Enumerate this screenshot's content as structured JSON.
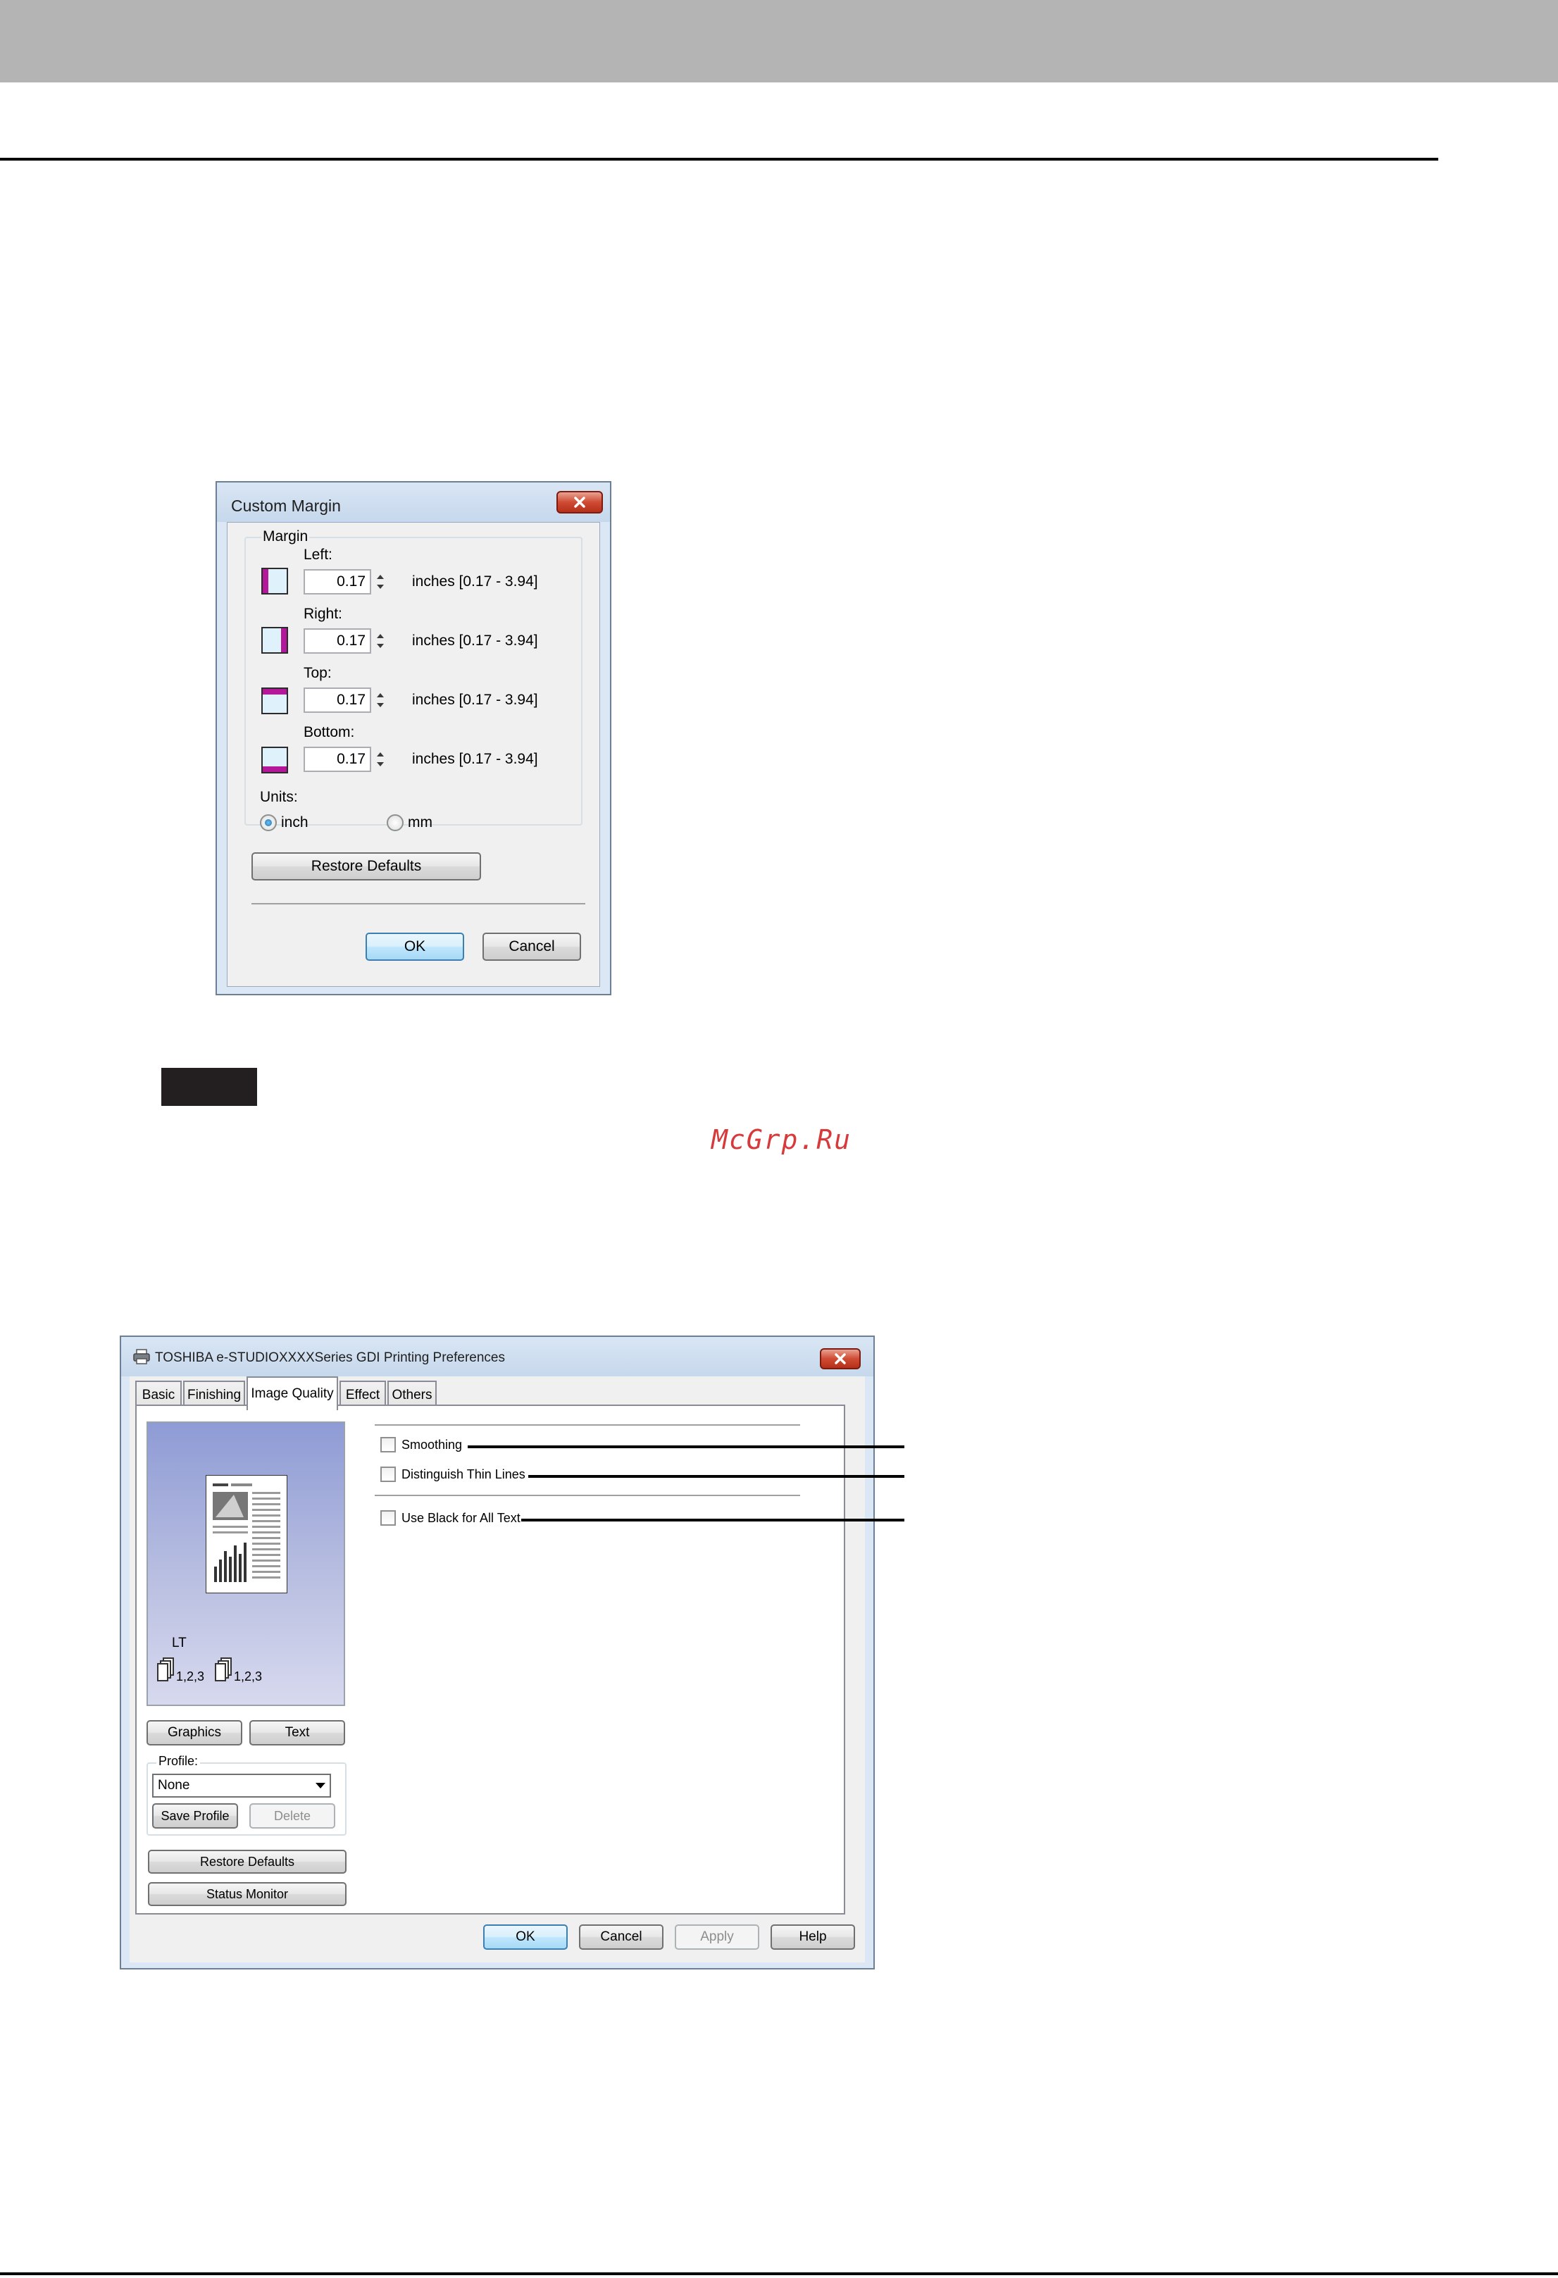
{
  "custom_margin": {
    "title": "Custom Margin",
    "group_label": "Margin",
    "fields": [
      {
        "label": "Left:",
        "value": "0.17",
        "range": "inches [0.17 - 3.94]"
      },
      {
        "label": "Right:",
        "value": "0.17",
        "range": "inches [0.17 - 3.94]"
      },
      {
        "label": "Top:",
        "value": "0.17",
        "range": "inches [0.17 - 3.94]"
      },
      {
        "label": "Bottom:",
        "value": "0.17",
        "range": "inches [0.17 - 3.94]"
      }
    ],
    "units_label": "Units:",
    "unit_options": [
      {
        "label": "inch",
        "selected": true
      },
      {
        "label": "mm",
        "selected": false
      }
    ],
    "restore_label": "Restore Defaults",
    "ok_label": "OK",
    "cancel_label": "Cancel"
  },
  "watermark": "McGrp.Ru",
  "prefs": {
    "title": "TOSHIBA e-STUDIOXXXXSeries GDI Printing Preferences",
    "tabs": [
      {
        "label": "Basic",
        "active": false
      },
      {
        "label": "Finishing",
        "active": false
      },
      {
        "label": "Image Quality",
        "active": true
      },
      {
        "label": "Effect",
        "active": false
      },
      {
        "label": "Others",
        "active": false
      }
    ],
    "preview": {
      "paper": "LT",
      "page_order_1": "1,2,3",
      "page_order_2": "1,2,3"
    },
    "graphics_label": "Graphics",
    "text_label": "Text",
    "profile_label": "Profile:",
    "profile_value": "None",
    "save_profile_label": "Save Profile",
    "delete_label": "Delete",
    "restore_label": "Restore Defaults",
    "status_monitor_label": "Status Monitor",
    "options": [
      {
        "label": "Smoothing",
        "checked": false
      },
      {
        "label": "Distinguish Thin Lines",
        "checked": false
      },
      {
        "label": "Use Black for All Text",
        "checked": false
      }
    ],
    "ok_label": "OK",
    "cancel_label": "Cancel",
    "apply_label": "Apply",
    "help_label": "Help"
  },
  "colors": {
    "accent": "#3c7fb1",
    "close": "#cf4b33",
    "preview_bg": "#8e9bd5",
    "watermark": "#d63a3a"
  }
}
